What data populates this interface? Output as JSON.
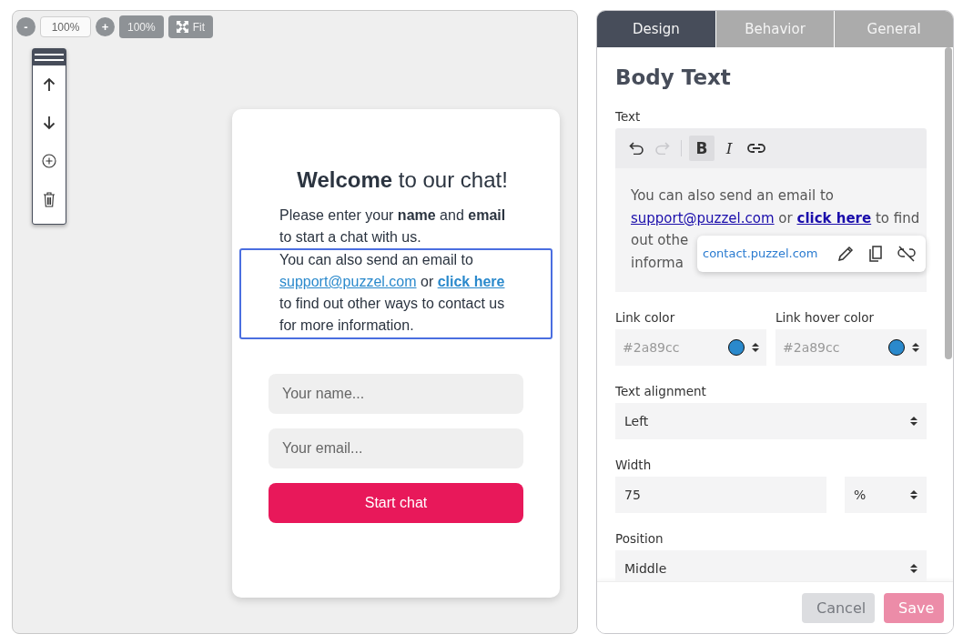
{
  "zoom_bar": {
    "minus": "-",
    "zoom_value": "100%",
    "plus": "+",
    "reset": "100%",
    "fit": "Fit"
  },
  "block_tools": [
    {
      "kind": "up"
    },
    {
      "kind": "down"
    },
    {
      "kind": "add"
    },
    {
      "kind": "delete"
    }
  ],
  "preview": {
    "title": "**Welcome** to our chat!",
    "intro": "Please enter your **name** and **email** to start a chat with us.",
    "selected_block": {
      "selected": true,
      "before": "You can also send an email to",
      "email_link": "support@puzzel.com",
      "middle": "or",
      "click_link": "click here",
      "after": "to find out other ways to contact us for more information."
    },
    "name_placeholder": "Your name...",
    "email_placeholder": "Your email...",
    "start_button": "Start chat"
  },
  "tabs": [
    {
      "label": "Design",
      "selected": true
    },
    {
      "label": "Behavior",
      "selected": false
    },
    {
      "label": "General",
      "selected": false
    }
  ],
  "heading": "Body Text",
  "text_label": "Text",
  "editor_tools": [
    {
      "kind": "undo",
      "disabled": false
    },
    {
      "kind": "redo",
      "disabled": true
    },
    {
      "kind": "bold",
      "glyph": "B",
      "active": true
    },
    {
      "kind": "italic",
      "glyph": "I",
      "active": false
    },
    {
      "kind": "link",
      "active": false
    }
  ],
  "editor": {
    "line_1": "You can also send an email to",
    "email_link": "support@puzzel.com",
    "middle": "or",
    "click_link": "click here",
    "tail": "to find",
    "cut_lines": [
      "out othe",
      "informa"
    ]
  },
  "link_popup": {
    "url": "contact.puzzel.com"
  },
  "color_fields": [
    {
      "label": "Link color",
      "placeholder": "#2a89cc",
      "color": "#2a89cc"
    },
    {
      "label": "Link hover color",
      "placeholder": "#2a89cc",
      "color": "#2a89cc"
    }
  ],
  "alignment": {
    "label": "Text alignment",
    "value": "Left"
  },
  "width": {
    "label": "Width",
    "value": "75",
    "unit": "%"
  },
  "position": {
    "label": "Position",
    "value": "Middle"
  },
  "buttons": {
    "cancel": "Cancel",
    "save": "Save",
    "disabled": true
  }
}
